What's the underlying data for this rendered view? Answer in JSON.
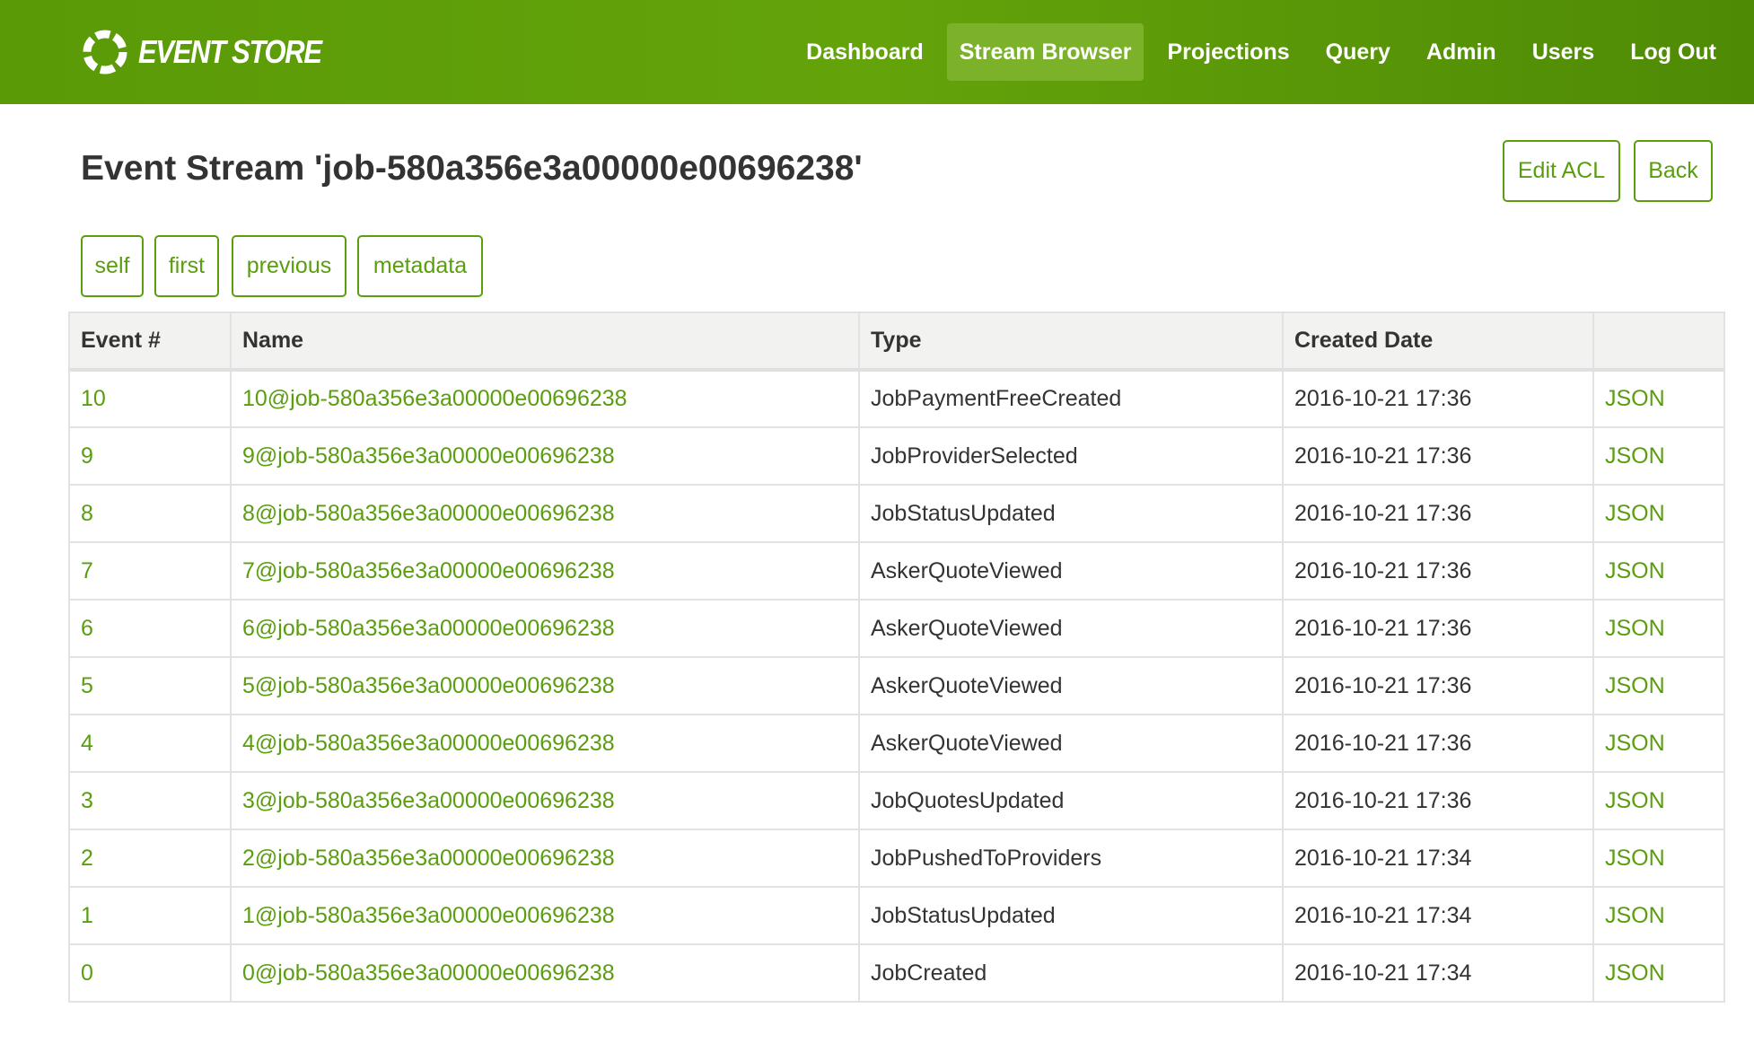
{
  "brand": {
    "name": "EVENT STORE"
  },
  "nav": {
    "items": [
      {
        "label": "Dashboard",
        "active": false
      },
      {
        "label": "Stream Browser",
        "active": true
      },
      {
        "label": "Projections",
        "active": false
      },
      {
        "label": "Query",
        "active": false
      },
      {
        "label": "Admin",
        "active": false
      },
      {
        "label": "Users",
        "active": false
      },
      {
        "label": "Log Out",
        "active": false
      }
    ]
  },
  "page": {
    "title": "Event Stream 'job-580a356e3a00000e00696238'",
    "edit_acl_label": "Edit ACL",
    "back_label": "Back"
  },
  "links": {
    "self": "self",
    "first": "first",
    "previous": "previous",
    "metadata": "metadata"
  },
  "table": {
    "headers": [
      "Event #",
      "Name",
      "Type",
      "Created Date",
      ""
    ],
    "rows": [
      {
        "num": "10",
        "name": "10@job-580a356e3a00000e00696238",
        "type": "JobPaymentFreeCreated",
        "date": "2016-10-21 17:36",
        "json": "JSON"
      },
      {
        "num": "9",
        "name": "9@job-580a356e3a00000e00696238",
        "type": "JobProviderSelected",
        "date": "2016-10-21 17:36",
        "json": "JSON"
      },
      {
        "num": "8",
        "name": "8@job-580a356e3a00000e00696238",
        "type": "JobStatusUpdated",
        "date": "2016-10-21 17:36",
        "json": "JSON"
      },
      {
        "num": "7",
        "name": "7@job-580a356e3a00000e00696238",
        "type": "AskerQuoteViewed",
        "date": "2016-10-21 17:36",
        "json": "JSON"
      },
      {
        "num": "6",
        "name": "6@job-580a356e3a00000e00696238",
        "type": "AskerQuoteViewed",
        "date": "2016-10-21 17:36",
        "json": "JSON"
      },
      {
        "num": "5",
        "name": "5@job-580a356e3a00000e00696238",
        "type": "AskerQuoteViewed",
        "date": "2016-10-21 17:36",
        "json": "JSON"
      },
      {
        "num": "4",
        "name": "4@job-580a356e3a00000e00696238",
        "type": "AskerQuoteViewed",
        "date": "2016-10-21 17:36",
        "json": "JSON"
      },
      {
        "num": "3",
        "name": "3@job-580a356e3a00000e00696238",
        "type": "JobQuotesUpdated",
        "date": "2016-10-21 17:36",
        "json": "JSON"
      },
      {
        "num": "2",
        "name": "2@job-580a356e3a00000e00696238",
        "type": "JobPushedToProviders",
        "date": "2016-10-21 17:34",
        "json": "JSON"
      },
      {
        "num": "1",
        "name": "1@job-580a356e3a00000e00696238",
        "type": "JobStatusUpdated",
        "date": "2016-10-21 17:34",
        "json": "JSON"
      },
      {
        "num": "0",
        "name": "0@job-580a356e3a00000e00696238",
        "type": "JobCreated",
        "date": "2016-10-21 17:34",
        "json": "JSON"
      }
    ]
  },
  "colors": {
    "brand_green": "#64a30a",
    "active_nav_bg": "#7bb22a",
    "link_green": "#5a9e0e",
    "text_dark": "#333333"
  },
  "icons": {
    "logo": "event-store-ring-icon"
  }
}
